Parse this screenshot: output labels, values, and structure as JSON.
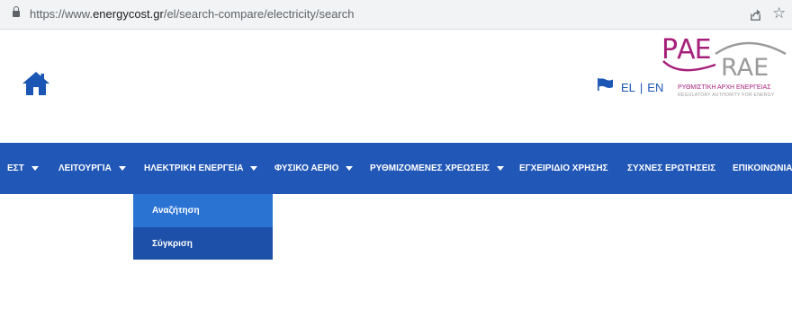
{
  "browser": {
    "url_prefix": "https://www.",
    "url_host": "energycost.gr",
    "url_path": "/el/search-compare/electricity/search",
    "icons": {
      "lock": "lock-icon",
      "share": "share-icon",
      "bookmark": "star-icon"
    }
  },
  "header": {
    "home_icon": "home-icon",
    "flag_icon": "eu-flag-icon",
    "lang_el": "EL",
    "lang_sep": "|",
    "lang_en": "EN",
    "logo": {
      "greek_acronym": "ΡΑΕ",
      "latin_acronym": "RAE",
      "name_el": "ΡΥΘΜΙΣΤΙΚΗ ΑΡΧΗ ΕΝΕΡΓΕΙΑΣ",
      "name_en": "REGULATORY AUTHORITY FOR ENERGY"
    }
  },
  "nav": {
    "background": "#2157b6",
    "items": [
      {
        "label": "ΕΣΤ",
        "has_dropdown": true
      },
      {
        "label": "ΛΕΙΤΟΥΡΓΙΑ",
        "has_dropdown": true
      },
      {
        "label": "ΗΛΕΚΤΡΙΚΗ ΕΝΕΡΓΕΙΑ",
        "has_dropdown": true
      },
      {
        "label": "ΦΥΣΙΚΟ ΑΕΡΙΟ",
        "has_dropdown": true
      },
      {
        "label": "ΡΥΘΜΙΖΟΜΕΝΕΣ ΧΡΕΩΣΕΙΣ",
        "has_dropdown": true
      },
      {
        "label": "ΕΓΧΕΙΡΙΔΙΟ ΧΡΗΣΗΣ",
        "has_dropdown": false
      },
      {
        "label": "ΣΥΧΝΕΣ ΕΡΩΤΗΣΕΙΣ",
        "has_dropdown": false
      },
      {
        "label": "ΕΠΙΚΟΙΝΩΝΙΑ",
        "has_dropdown": false
      }
    ],
    "dropdown": {
      "parent": "ΗΛΕΚΤΡΙΚΗ ΕΝΕΡΓΕΙΑ",
      "items": [
        {
          "label": "Αναζήτηση",
          "active": true
        },
        {
          "label": "Σύγκριση",
          "active": false
        }
      ],
      "active_color": "#2b73d3",
      "item_color": "#1d50a8"
    }
  }
}
